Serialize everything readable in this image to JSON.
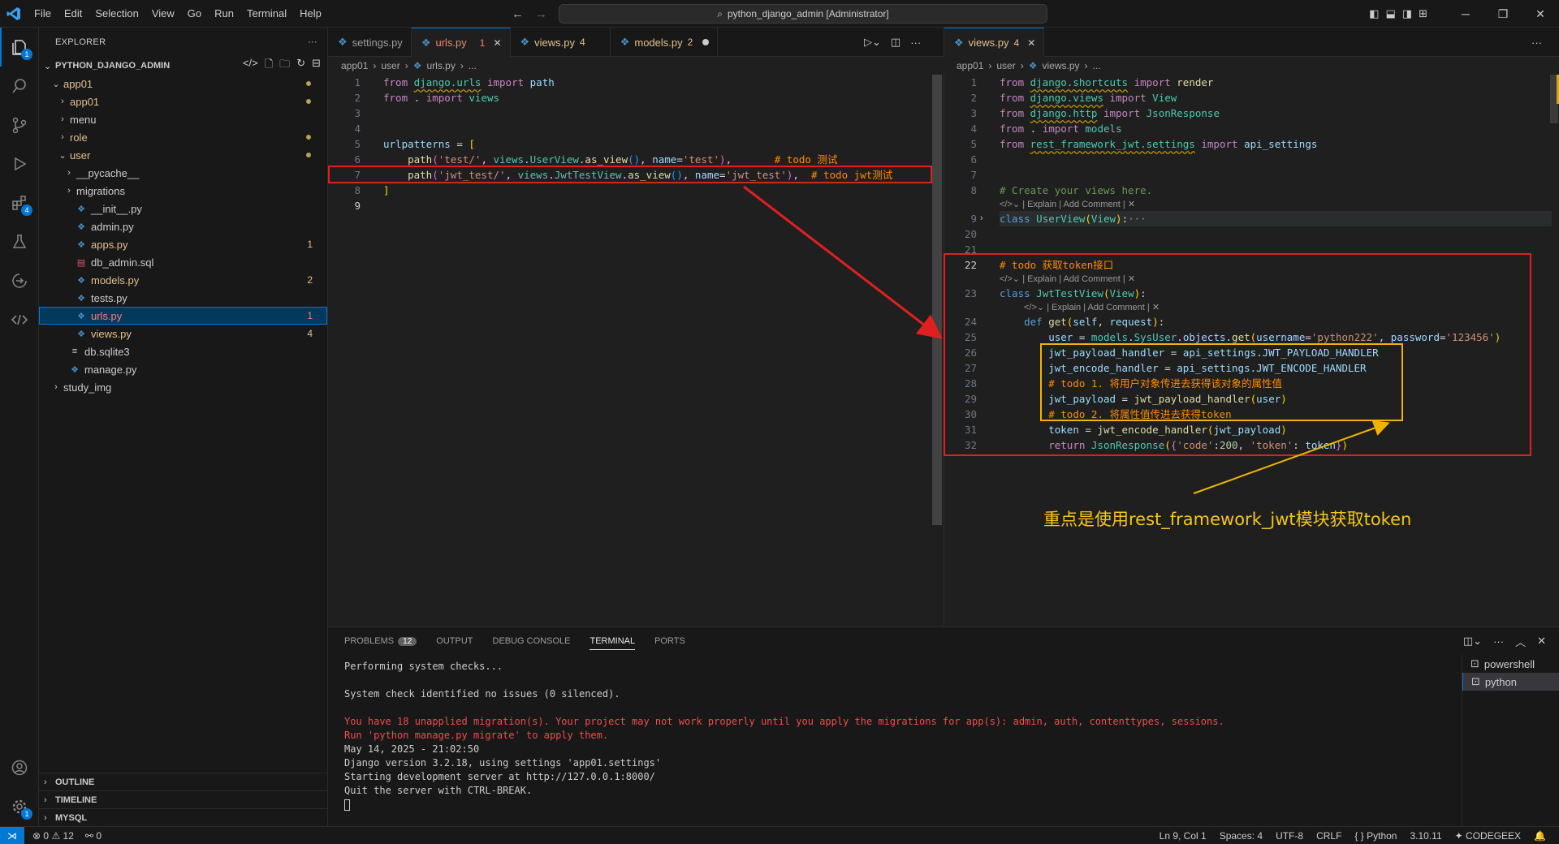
{
  "titlebar": {
    "menus": [
      "File",
      "Edit",
      "Selection",
      "View",
      "Go",
      "Run",
      "Terminal",
      "Help"
    ],
    "search_text": "python_django_admin [Administrator]"
  },
  "activitybar": {
    "explorer_badge": "1",
    "extensions_badge": "4",
    "settings_badge": "1"
  },
  "sidebar": {
    "title": "EXPLORER",
    "project": "PYTHON_DJANGO_ADMIN",
    "tree": [
      {
        "label": "app01",
        "depth": 1,
        "type": "folder-open",
        "state": "modified"
      },
      {
        "label": "app01",
        "depth": 2,
        "type": "folder",
        "state": "modified"
      },
      {
        "label": "menu",
        "depth": 2,
        "type": "folder",
        "state": "normal"
      },
      {
        "label": "role",
        "depth": 2,
        "type": "folder",
        "state": "modified"
      },
      {
        "label": "user",
        "depth": 2,
        "type": "folder-open",
        "state": "modified"
      },
      {
        "label": "__pycache__",
        "depth": 3,
        "type": "folder",
        "state": "normal"
      },
      {
        "label": "migrations",
        "depth": 3,
        "type": "folder",
        "state": "normal"
      },
      {
        "label": "__init__.py",
        "depth": 3,
        "type": "py",
        "state": "normal"
      },
      {
        "label": "admin.py",
        "depth": 3,
        "type": "py",
        "state": "normal"
      },
      {
        "label": "apps.py",
        "depth": 3,
        "type": "py",
        "state": "modified",
        "count": "1"
      },
      {
        "label": "db_admin.sql",
        "depth": 3,
        "type": "sql",
        "state": "normal"
      },
      {
        "label": "models.py",
        "depth": 3,
        "type": "py",
        "state": "modified",
        "count": "2"
      },
      {
        "label": "tests.py",
        "depth": 3,
        "type": "py",
        "state": "normal"
      },
      {
        "label": "urls.py",
        "depth": 3,
        "type": "py",
        "state": "selected",
        "count": "1"
      },
      {
        "label": "views.py",
        "depth": 3,
        "type": "py",
        "state": "modified",
        "count": "4"
      },
      {
        "label": "db.sqlite3",
        "depth": 2,
        "type": "db",
        "state": "normal"
      },
      {
        "label": "manage.py",
        "depth": 2,
        "type": "py",
        "state": "normal"
      },
      {
        "label": "study_img",
        "depth": 1,
        "type": "folder",
        "state": "normal"
      }
    ],
    "sections": [
      "OUTLINE",
      "TIMELINE",
      "MYSQL"
    ]
  },
  "left_editor": {
    "tabs": [
      {
        "name": "settings.py",
        "count": "",
        "active": false
      },
      {
        "name": "urls.py",
        "count": "1",
        "active": true
      },
      {
        "name": "views.py",
        "count": "4",
        "active": false
      },
      {
        "name": "models.py",
        "count": "2",
        "active": false
      }
    ],
    "breadcrumb": [
      "app01",
      "user",
      "urls.py",
      "..."
    ]
  },
  "right_editor": {
    "tabs": [
      {
        "name": "views.py",
        "count": "4",
        "active": true
      }
    ],
    "breadcrumb": [
      "app01",
      "user",
      "views.py",
      "..."
    ],
    "codelens": "| Explain | Add Comment |"
  },
  "annotation": "重点是使用rest_framework_jwt模块获取token",
  "panel": {
    "tabs": [
      "PROBLEMS",
      "OUTPUT",
      "DEBUG CONSOLE",
      "TERMINAL",
      "PORTS"
    ],
    "problems_count": "12",
    "terminal_lines": [
      {
        "text": "Performing system checks...",
        "style": "normal"
      },
      {
        "text": "",
        "style": "normal"
      },
      {
        "text": "System check identified no issues (0 silenced).",
        "style": "normal"
      },
      {
        "text": "",
        "style": "normal"
      },
      {
        "text": "You have 18 unapplied migration(s). Your project may not work properly until you apply the migrations for app(s): admin, auth, contenttypes, sessions.",
        "style": "red"
      },
      {
        "text": "Run 'python manage.py migrate' to apply them.",
        "style": "red"
      },
      {
        "text": "May 14, 2025 - 21:02:50",
        "style": "normal"
      },
      {
        "text": "Django version 3.2.18, using settings 'app01.settings'",
        "style": "normal"
      },
      {
        "text": "Starting development server at http://127.0.0.1:8000/",
        "style": "normal"
      },
      {
        "text": "Quit the server with CTRL-BREAK.",
        "style": "normal"
      }
    ],
    "terminals": [
      "powershell",
      "python"
    ]
  },
  "statusbar": {
    "errors": "0",
    "warnings": "12",
    "ports": "0",
    "position": "Ln 9, Col 1",
    "spaces": "Spaces: 4",
    "encoding": "UTF-8",
    "eol": "CRLF",
    "language": "Python",
    "version": "3.10.11",
    "codegeex": "CODEGEEX"
  }
}
